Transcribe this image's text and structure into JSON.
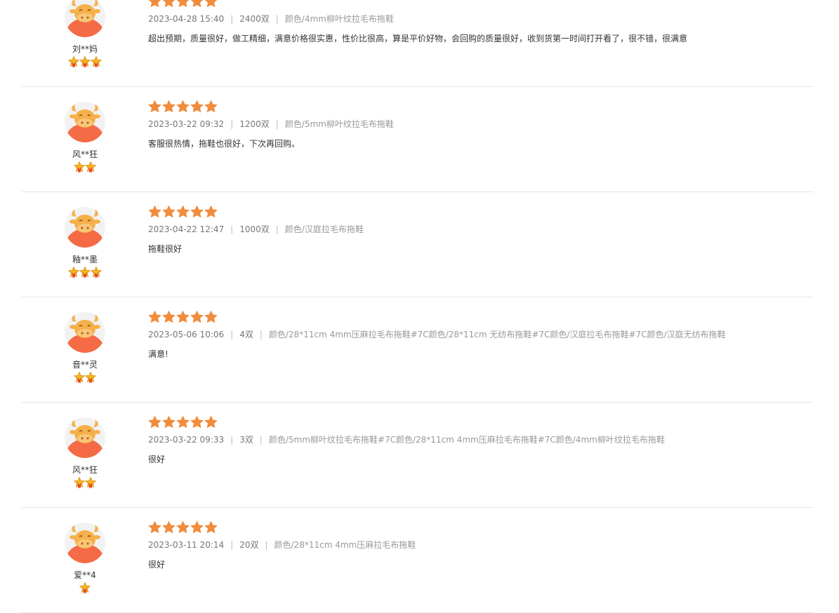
{
  "colors": {
    "star": "#f08c3c",
    "avatar_bg": "#f2f2f2",
    "avatar_body": "#f46b45",
    "avatar_head": "#f6b04a",
    "badge": "#f4b622",
    "badge_ribbon": "#e0432a",
    "divider": "#e6e6e6"
  },
  "reviews": [
    {
      "user": "刘**妈",
      "level_badges": 3,
      "rating": 5,
      "date": "2023-04-28 15:40",
      "quantity": "2400双",
      "spec": "颜色/4mm柳叶纹拉毛布拖鞋",
      "comment": "超出预期，质量很好，做工精细，满意价格很实惠，性价比很高，算是平价好物，会回购的质量很好，收到货第一时间打开看了，很不错，很满意"
    },
    {
      "user": "风**狂",
      "level_badges": 2,
      "rating": 5,
      "date": "2023-03-22 09:32",
      "quantity": "1200双",
      "spec": "颜色/5mm柳叶纹拉毛布拖鞋",
      "comment": "客服很热情，拖鞋也很好，下次再回购。"
    },
    {
      "user": "釉**墨",
      "level_badges": 3,
      "rating": 5,
      "date": "2023-04-22 12:47",
      "quantity": "1000双",
      "spec": "颜色/汉庭拉毛布拖鞋",
      "comment": "拖鞋很好"
    },
    {
      "user": "音**灵",
      "level_badges": 2,
      "rating": 5,
      "date": "2023-05-06 10:06",
      "quantity": "4双",
      "spec": "颜色/28*11cm 4mm压麻拉毛布拖鞋#7C颜色/28*11cm 无纺布拖鞋#7C颜色/汉庭拉毛布拖鞋#7C颜色/汉庭无纺布拖鞋",
      "comment": "满意!"
    },
    {
      "user": "风**狂",
      "level_badges": 2,
      "rating": 5,
      "date": "2023-03-22 09:33",
      "quantity": "3双",
      "spec": "颜色/5mm柳叶纹拉毛布拖鞋#7C颜色/28*11cm 4mm压麻拉毛布拖鞋#7C颜色/4mm柳叶纹拉毛布拖鞋",
      "comment": "很好"
    },
    {
      "user": "爱**4",
      "level_badges": 1,
      "rating": 5,
      "date": "2023-03-11 20:14",
      "quantity": "20双",
      "spec": "颜色/28*11cm 4mm压麻拉毛布拖鞋",
      "comment": "很好"
    }
  ]
}
